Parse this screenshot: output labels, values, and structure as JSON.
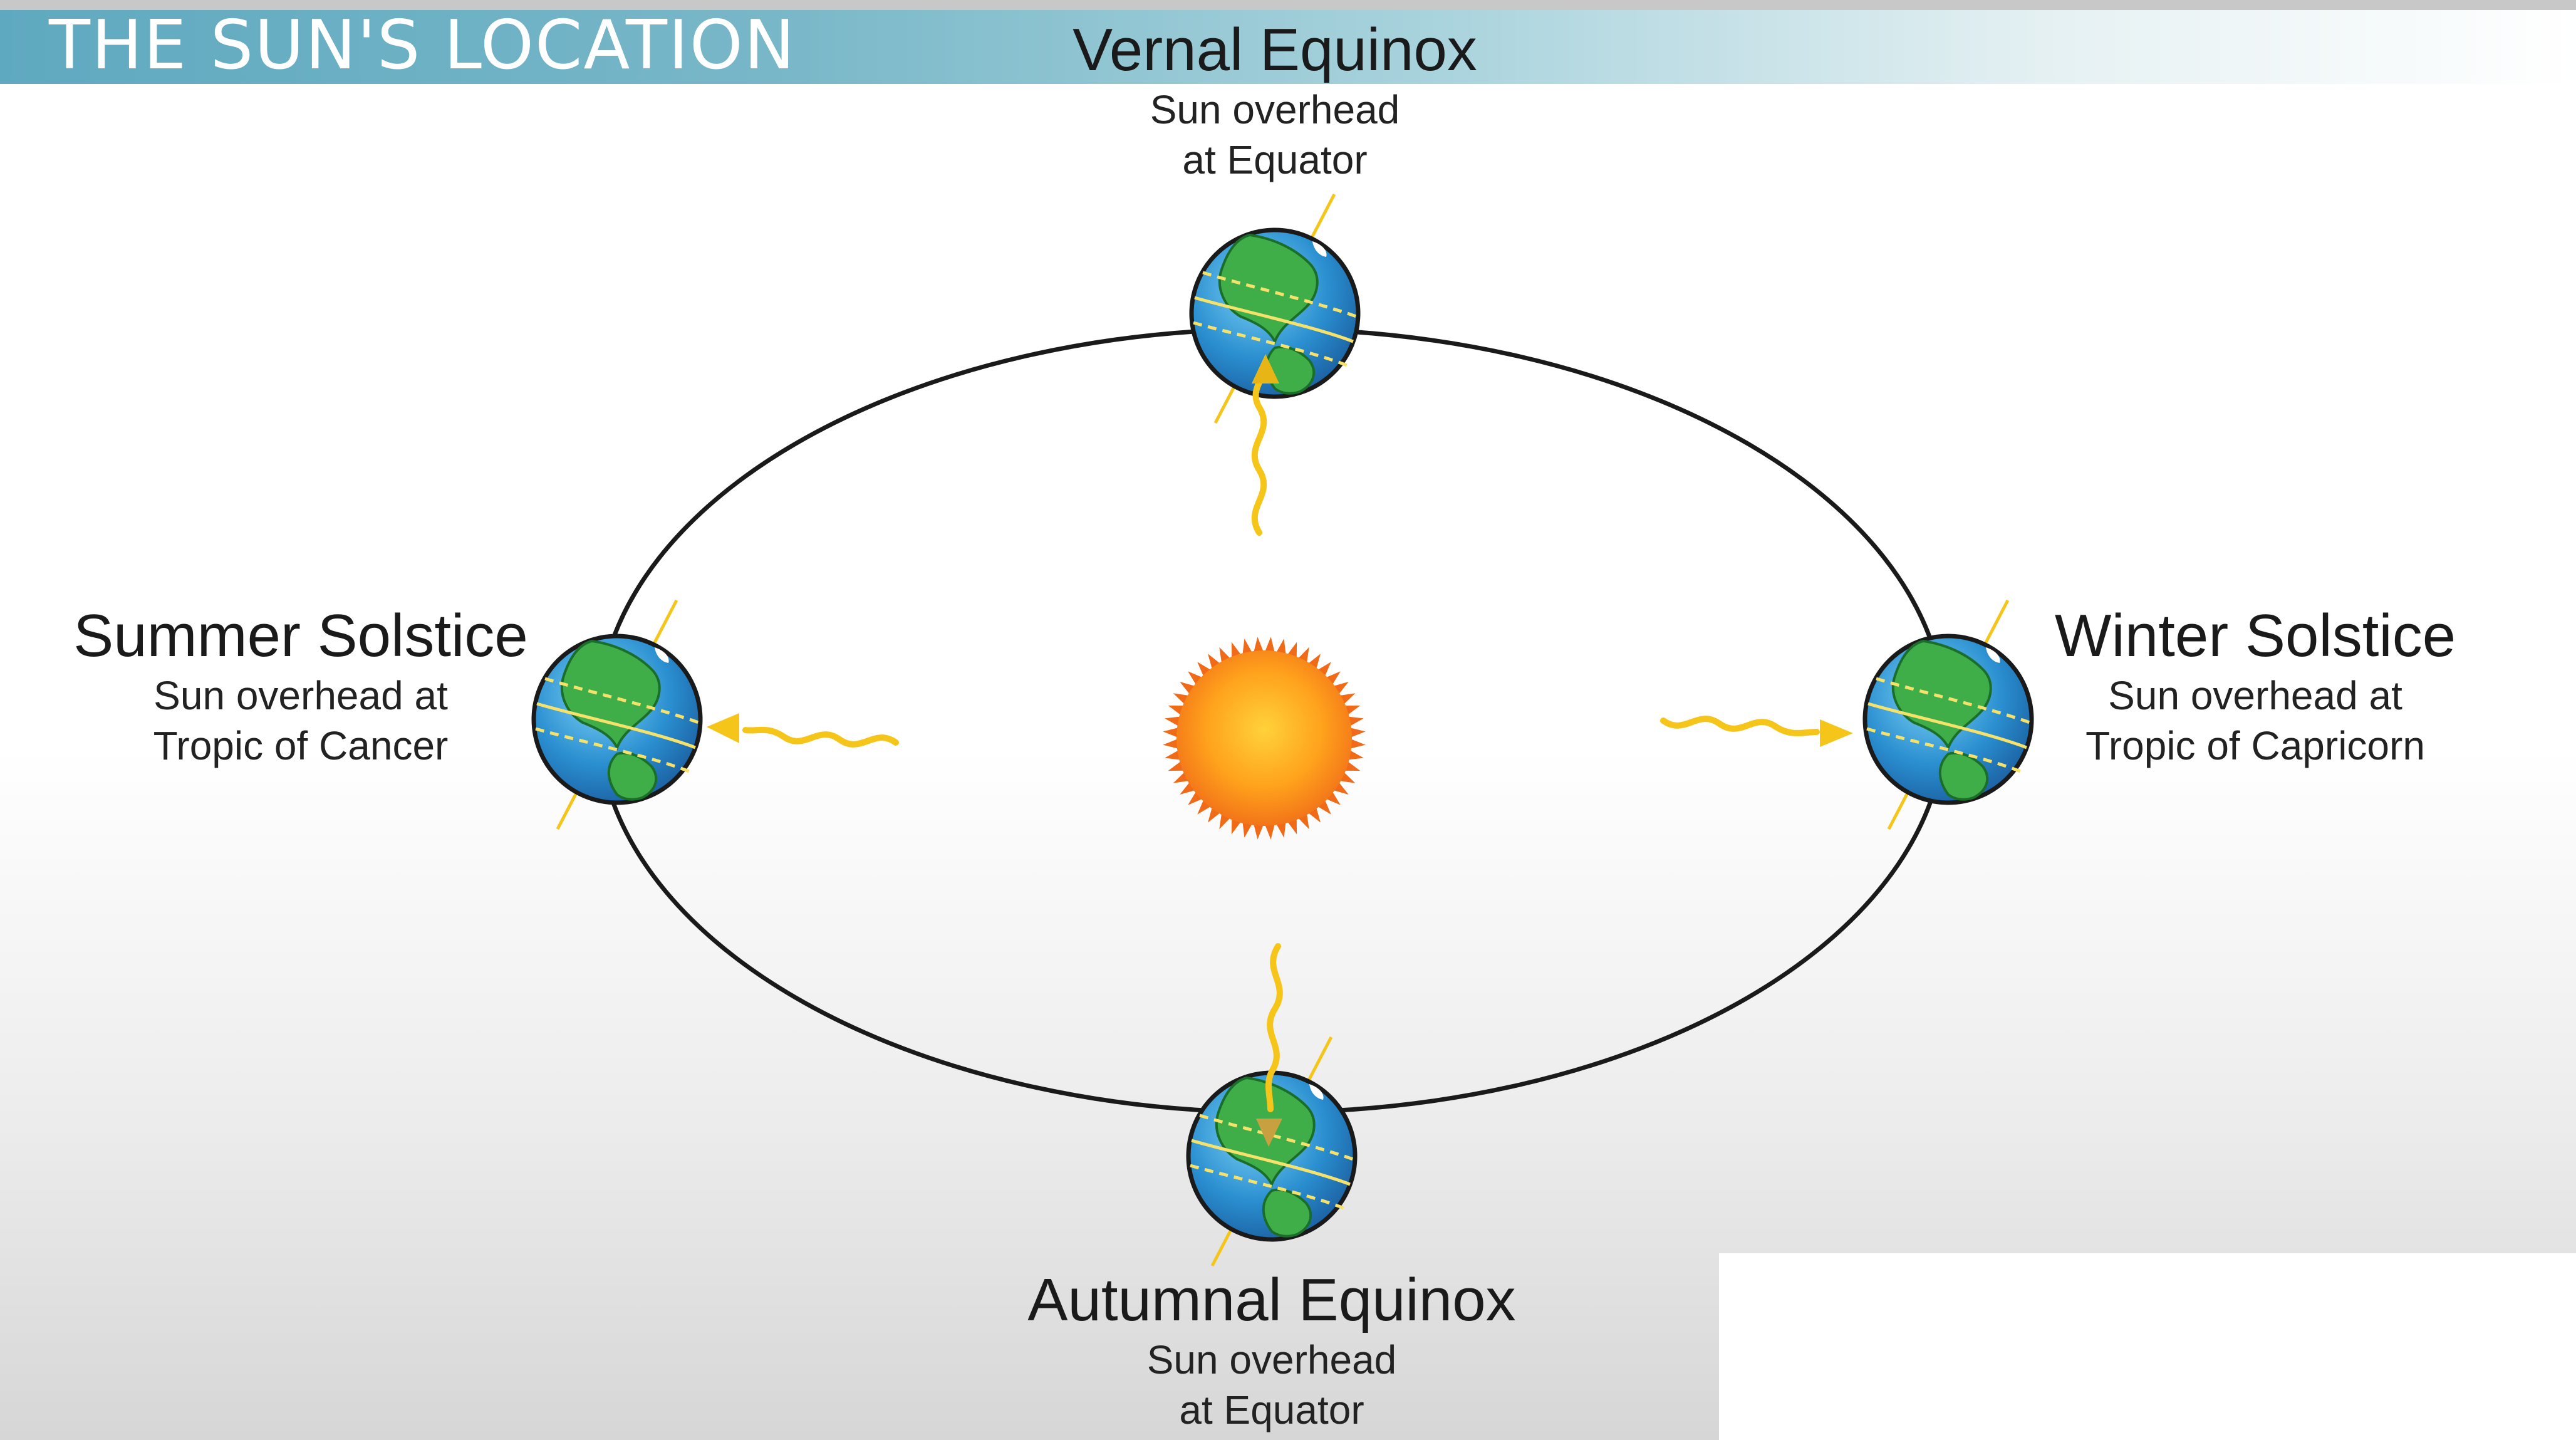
{
  "header": {
    "title": "THE SUN'S LOCATION"
  },
  "positions": {
    "vernal": {
      "title": "Vernal Equinox",
      "line1": "Sun overhead",
      "line2": "at Equator"
    },
    "summer": {
      "title": "Summer Solstice",
      "line1": "Sun overhead at",
      "line2": "Tropic of Cancer"
    },
    "winter": {
      "title": "Winter Solstice",
      "line1": "Sun overhead at",
      "line2": "Tropic of Capricorn"
    },
    "autumnal": {
      "title": "Autumnal Equinox",
      "line1": "Sun overhead",
      "line2": "at Equator"
    }
  },
  "colors": {
    "ocean": "#2a8fd0",
    "land": "#3fae49",
    "sun_center": "#ffd23a",
    "sun_edge": "#f06a18",
    "sun_ray": "#f5c51a",
    "orbit": "#1a1a1a"
  },
  "icons": [
    "sun-icon",
    "earth-icon",
    "sun-ray-arrow-icon"
  ]
}
